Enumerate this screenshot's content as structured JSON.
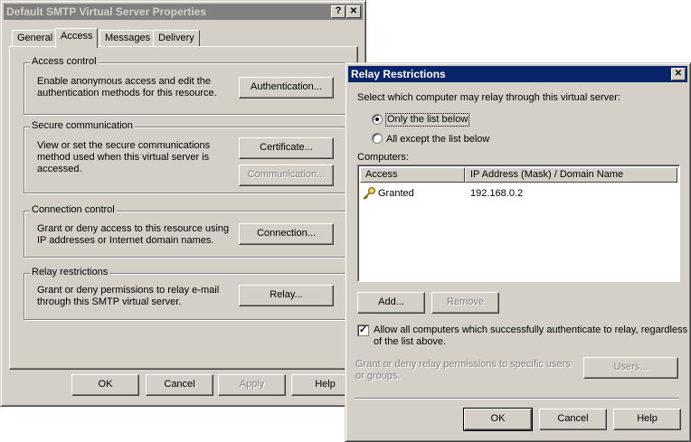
{
  "main_dialog": {
    "title": "Default SMTP Virtual Server Properties",
    "help_btn": "?",
    "close_btn": "✕",
    "tabs": [
      {
        "label": "General"
      },
      {
        "label": "Access"
      },
      {
        "label": "Messages"
      },
      {
        "label": "Delivery"
      }
    ],
    "access_control": {
      "legend": "Access control",
      "text": "Enable anonymous access and edit the authentication methods for this resource.",
      "button": "Authentication..."
    },
    "secure_communication": {
      "legend": "Secure communication",
      "text": "View or set the secure communications method used when this virtual server is accessed.",
      "certificate_button": "Certificate...",
      "communication_button": "Communication..."
    },
    "connection_control": {
      "legend": "Connection control",
      "text": "Grant or deny access to this resource using IP addresses or Internet domain names.",
      "button": "Connection..."
    },
    "relay_restrictions": {
      "legend": "Relay restrictions",
      "text": "Grant or deny permissions to relay e-mail through this SMTP virtual server.",
      "button": "Relay..."
    },
    "footer": {
      "ok": "OK",
      "cancel": "Cancel",
      "apply": "Apply",
      "help": "Help"
    }
  },
  "relay_dialog": {
    "title": "Relay Restrictions",
    "close_btn": "✕",
    "prompt": "Select which computer may relay through this virtual server:",
    "radio_only": "Only the list below",
    "radio_all_except": "All except the list below",
    "selected_radio": "only",
    "computers_label": "Computers:",
    "columns": [
      "Access",
      "IP Address (Mask) / Domain Name"
    ],
    "rows": [
      {
        "access": "Granted",
        "address": "192.168.0.2",
        "icon": "key-icon"
      }
    ],
    "add_button": "Add...",
    "remove_button": "Remove",
    "allow_auth_checked": true,
    "allow_auth_text_line1": "Allow all computers which successfully authenticate to relay, regardless",
    "allow_auth_text_line2": "of the list above.",
    "users_text": "Grant or deny relay permissions to specific users or groups.",
    "users_button": "Users...",
    "ok": "OK",
    "cancel": "Cancel",
    "help": "Help"
  },
  "colors": {
    "dialog_face": "#d4d0c8",
    "active_title": "#0a246a",
    "inactive_title": "#808080"
  }
}
